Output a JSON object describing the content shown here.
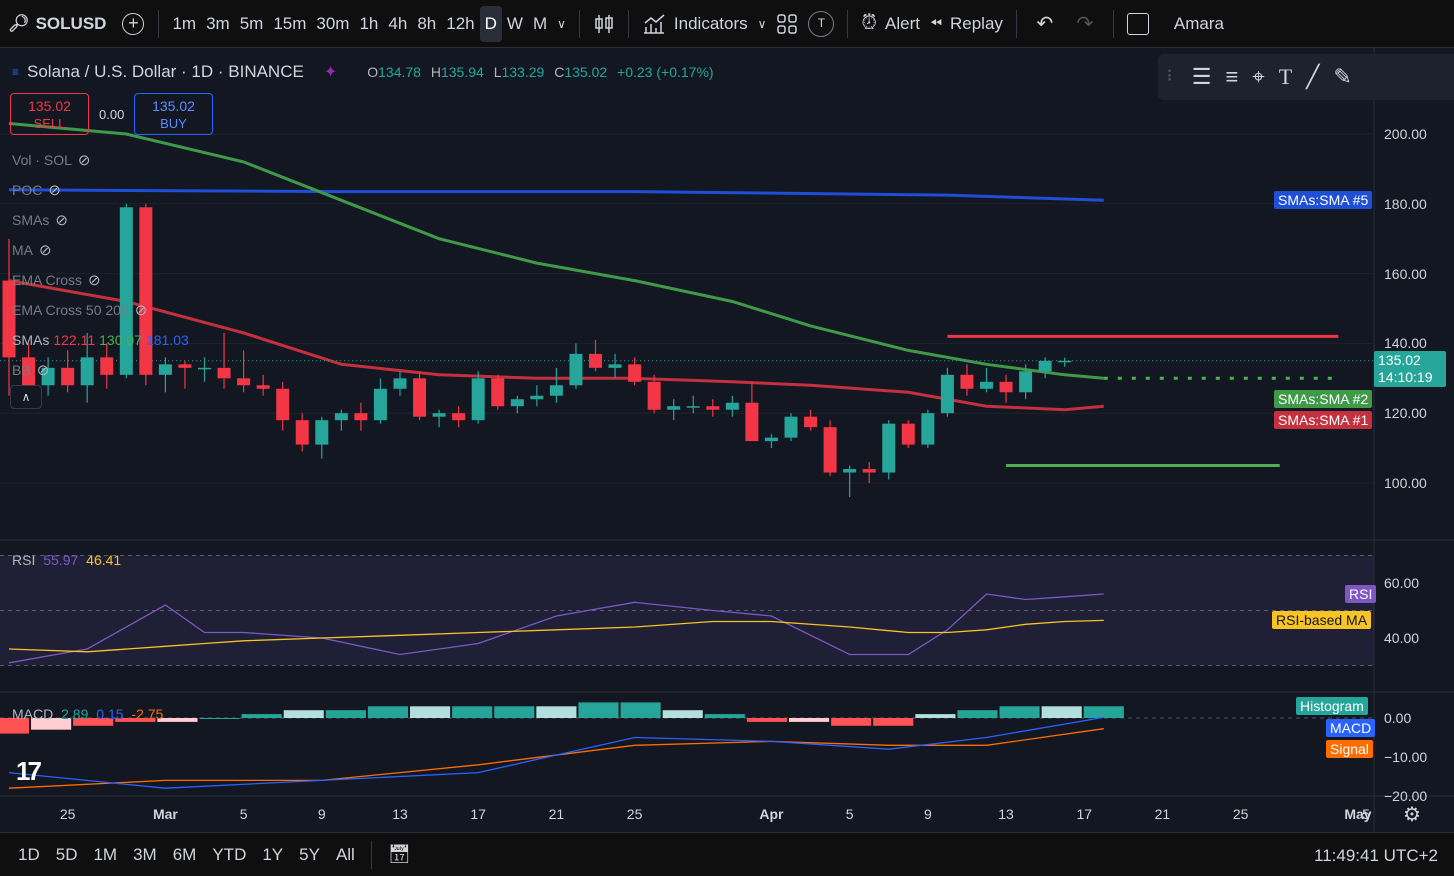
{
  "toolbar": {
    "symbol": "SOLUSD",
    "timeframes": [
      "1m",
      "3m",
      "5m",
      "15m",
      "30m",
      "1h",
      "4h",
      "8h",
      "12h",
      "D",
      "W",
      "M"
    ],
    "active_timeframe": "D",
    "indicators_label": "Indicators",
    "alert_label": "Alert",
    "replay_label": "Replay",
    "user_label": "Amara"
  },
  "header": {
    "title": "Solana / U.S. Dollar · 1D · BINANCE",
    "o_label": "O",
    "o": "134.78",
    "h_label": "H",
    "h": "135.94",
    "l_label": "L",
    "l": "133.29",
    "c_label": "C",
    "c": "135.02",
    "change": "+0.23 (+0.17%)"
  },
  "trade": {
    "sell_price": "135.02",
    "sell_label": "SELL",
    "buy_price": "135.02",
    "buy_label": "BUY",
    "spread": "0.00"
  },
  "indicators": {
    "vol": "Vol · SOL",
    "poc": "POC",
    "smas": "SMAs",
    "ma": "MA",
    "ema_cross": "EMA Cross",
    "ema_cross_50_200": "EMA Cross 50 200",
    "smas_values_label": "SMAs",
    "sma1_val": "122.11",
    "sma2_val": "130.07",
    "sma5_val": "181.03",
    "bb": "BB"
  },
  "rsi_pane": {
    "label": "RSI",
    "rsi_val": "55.97",
    "ma_val": "46.41",
    "tag_rsi": "RSI",
    "tag_ma": "RSI-based MA"
  },
  "macd_pane": {
    "label": "MACD",
    "hist_val": "2.89",
    "macd_val": "0.15",
    "signal_val": "-2.75",
    "tag_hist": "Histogram",
    "tag_macd": "MACD",
    "tag_signal": "Signal"
  },
  "price_axis": {
    "labels": [
      "200.00",
      "180.00",
      "160.00",
      "140.00",
      "120.00",
      "100.00"
    ],
    "current_price": "135.02",
    "countdown": "14:10:19",
    "tag_sma5": "SMAs:SMA #5",
    "tag_sma2": "SMAs:SMA #2",
    "tag_sma1": "SMAs:SMA #1"
  },
  "rsi_axis": {
    "labels": [
      "60.00",
      "40.00"
    ]
  },
  "macd_axis": {
    "labels": [
      "0.00",
      "−10.00",
      "−20.00"
    ]
  },
  "date_axis": {
    "labels": [
      "25",
      "Mar",
      "5",
      "9",
      "13",
      "17",
      "21",
      "25",
      "Apr",
      "5",
      "9",
      "13",
      "17",
      "21",
      "25",
      "May",
      "5"
    ]
  },
  "bottombar": {
    "ranges": [
      "1D",
      "5D",
      "1M",
      "3M",
      "6M",
      "YTD",
      "1Y",
      "5Y",
      "All"
    ],
    "clock": "11:49:41 UTC+2"
  },
  "colors": {
    "up": "#26a69a",
    "down": "#f23645",
    "sma1": "#c2313d",
    "sma2": "#3f9a48",
    "sma5": "#1e4fd6",
    "rsi": "#7e57c2",
    "rsi_ma": "#f7c325",
    "macd": "#2962ff",
    "signal": "#ff6d00"
  },
  "chart_data": {
    "type": "candlestick",
    "symbol": "SOLUSD",
    "interval": "1D",
    "exchange": "BINANCE",
    "x_range": [
      "2024-02-22",
      "2024-04-18"
    ],
    "candles": [
      {
        "date": "2024-02-22",
        "o": 158,
        "h": 170,
        "l": 125,
        "c": 136
      },
      {
        "date": "2024-02-23",
        "o": 136,
        "h": 140,
        "l": 124,
        "c": 127
      },
      {
        "date": "2024-02-24",
        "o": 128,
        "h": 136,
        "l": 125,
        "c": 133
      },
      {
        "date": "2024-02-25",
        "o": 133,
        "h": 138,
        "l": 126,
        "c": 128
      },
      {
        "date": "2024-02-26",
        "o": 128,
        "h": 143,
        "l": 123,
        "c": 136
      },
      {
        "date": "2024-02-27",
        "o": 136,
        "h": 140,
        "l": 127,
        "c": 131
      },
      {
        "date": "2024-02-28",
        "o": 131,
        "h": 180,
        "l": 130,
        "c": 179
      },
      {
        "date": "2024-02-29",
        "o": 179,
        "h": 180,
        "l": 128,
        "c": 131
      },
      {
        "date": "2024-03-01",
        "o": 131,
        "h": 136,
        "l": 126,
        "c": 134
      },
      {
        "date": "2024-03-02",
        "o": 134,
        "h": 135,
        "l": 127,
        "c": 133
      },
      {
        "date": "2024-03-03",
        "o": 133,
        "h": 136,
        "l": 129,
        "c": 133
      },
      {
        "date": "2024-03-04",
        "o": 133,
        "h": 143,
        "l": 127,
        "c": 130
      },
      {
        "date": "2024-03-05",
        "o": 130,
        "h": 138,
        "l": 126,
        "c": 128
      },
      {
        "date": "2024-03-06",
        "o": 128,
        "h": 131,
        "l": 125,
        "c": 127
      },
      {
        "date": "2024-03-07",
        "o": 127,
        "h": 129,
        "l": 115,
        "c": 118
      },
      {
        "date": "2024-03-08",
        "o": 118,
        "h": 120,
        "l": 109,
        "c": 111
      },
      {
        "date": "2024-03-09",
        "o": 111,
        "h": 119,
        "l": 107,
        "c": 118
      },
      {
        "date": "2024-03-10",
        "o": 118,
        "h": 121,
        "l": 115,
        "c": 120
      },
      {
        "date": "2024-03-11",
        "o": 120,
        "h": 123,
        "l": 115,
        "c": 118
      },
      {
        "date": "2024-03-12",
        "o": 118,
        "h": 130,
        "l": 117,
        "c": 127
      },
      {
        "date": "2024-03-13",
        "o": 127,
        "h": 132,
        "l": 125,
        "c": 130
      },
      {
        "date": "2024-03-14",
        "o": 130,
        "h": 132,
        "l": 118,
        "c": 119
      },
      {
        "date": "2024-03-15",
        "o": 119,
        "h": 121,
        "l": 116,
        "c": 120
      },
      {
        "date": "2024-03-16",
        "o": 120,
        "h": 122,
        "l": 116,
        "c": 118
      },
      {
        "date": "2024-03-17",
        "o": 118,
        "h": 132,
        "l": 117,
        "c": 130
      },
      {
        "date": "2024-03-18",
        "o": 130,
        "h": 131,
        "l": 121,
        "c": 122
      },
      {
        "date": "2024-03-19",
        "o": 122,
        "h": 125,
        "l": 120,
        "c": 124
      },
      {
        "date": "2024-03-20",
        "o": 124,
        "h": 128,
        "l": 122,
        "c": 125
      },
      {
        "date": "2024-03-21",
        "o": 125,
        "h": 133,
        "l": 123,
        "c": 128
      },
      {
        "date": "2024-03-22",
        "o": 128,
        "h": 140,
        "l": 127,
        "c": 137
      },
      {
        "date": "2024-03-23",
        "o": 137,
        "h": 141,
        "l": 132,
        "c": 133
      },
      {
        "date": "2024-03-24",
        "o": 133,
        "h": 137,
        "l": 130,
        "c": 134
      },
      {
        "date": "2024-03-25",
        "o": 134,
        "h": 136,
        "l": 128,
        "c": 129
      },
      {
        "date": "2024-03-26",
        "o": 129,
        "h": 131,
        "l": 120,
        "c": 121
      },
      {
        "date": "2024-03-27",
        "o": 121,
        "h": 124,
        "l": 118,
        "c": 122
      },
      {
        "date": "2024-03-28",
        "o": 122,
        "h": 125,
        "l": 120,
        "c": 122
      },
      {
        "date": "2024-03-29",
        "o": 122,
        "h": 124,
        "l": 119,
        "c": 121
      },
      {
        "date": "2024-03-30",
        "o": 121,
        "h": 125,
        "l": 119,
        "c": 123
      },
      {
        "date": "2024-03-31",
        "o": 123,
        "h": 129,
        "l": 118,
        "c": 112
      },
      {
        "date": "2024-04-01",
        "o": 112,
        "h": 114,
        "l": 110,
        "c": 113
      },
      {
        "date": "2024-04-02",
        "o": 113,
        "h": 120,
        "l": 112,
        "c": 119
      },
      {
        "date": "2024-04-03",
        "o": 119,
        "h": 121,
        "l": 115,
        "c": 116
      },
      {
        "date": "2024-04-04",
        "o": 116,
        "h": 118,
        "l": 102,
        "c": 103
      },
      {
        "date": "2024-04-05",
        "o": 103,
        "h": 105,
        "l": 96,
        "c": 104
      },
      {
        "date": "2024-04-06",
        "o": 104,
        "h": 106,
        "l": 100,
        "c": 103
      },
      {
        "date": "2024-04-07",
        "o": 103,
        "h": 118,
        "l": 101,
        "c": 117
      },
      {
        "date": "2024-04-08",
        "o": 117,
        "h": 118,
        "l": 110,
        "c": 111
      },
      {
        "date": "2024-04-09",
        "o": 111,
        "h": 121,
        "l": 110,
        "c": 120
      },
      {
        "date": "2024-04-10",
        "o": 120,
        "h": 133,
        "l": 119,
        "c": 131
      },
      {
        "date": "2024-04-11",
        "o": 131,
        "h": 134,
        "l": 125,
        "c": 127
      },
      {
        "date": "2024-04-12",
        "o": 127,
        "h": 133,
        "l": 126,
        "c": 129
      },
      {
        "date": "2024-04-13",
        "o": 129,
        "h": 131,
        "l": 123,
        "c": 126
      },
      {
        "date": "2024-04-14",
        "o": 126,
        "h": 134,
        "l": 124,
        "c": 132
      },
      {
        "date": "2024-04-15",
        "o": 132,
        "h": 136,
        "l": 130,
        "c": 135
      },
      {
        "date": "2024-04-16",
        "o": 134.78,
        "h": 135.94,
        "l": 133.29,
        "c": 135.02
      }
    ],
    "sma1": {
      "name": "SMAs:SMA #1",
      "dates": [
        "2024-02-22",
        "2024-02-28",
        "2024-03-05",
        "2024-03-10",
        "2024-03-15",
        "2024-03-20",
        "2024-03-25",
        "2024-03-30",
        "2024-04-03",
        "2024-04-08",
        "2024-04-12",
        "2024-04-16",
        "2024-04-18"
      ],
      "values": [
        158,
        152,
        143,
        134,
        131,
        130,
        130,
        129,
        128,
        126,
        122,
        121,
        122
      ]
    },
    "sma2": {
      "name": "SMAs:SMA #2",
      "dates": [
        "2024-02-22",
        "2024-02-28",
        "2024-03-05",
        "2024-03-10",
        "2024-03-15",
        "2024-03-20",
        "2024-03-25",
        "2024-03-30",
        "2024-04-03",
        "2024-04-08",
        "2024-04-12",
        "2024-04-16",
        "2024-04-18"
      ],
      "values": [
        203,
        200,
        192,
        181,
        170,
        163,
        158,
        152,
        145,
        138,
        134,
        131,
        130
      ]
    },
    "sma5": {
      "name": "SMAs:SMA #5",
      "dates": [
        "2024-02-22",
        "2024-03-10",
        "2024-03-25",
        "2024-04-10",
        "2024-04-18"
      ],
      "values": [
        184,
        183.5,
        183.5,
        182.5,
        181
      ]
    },
    "horizontal_lines": [
      {
        "color": "#f23645",
        "value": 142,
        "from": "2024-04-10",
        "to": "2024-04-30"
      },
      {
        "color": "#4caf50",
        "value": 130,
        "from": "2024-04-18",
        "to": "2024-04-30",
        "style": "dotted"
      },
      {
        "color": "#4caf50",
        "value": 105,
        "from": "2024-04-13",
        "to": "2024-04-27"
      }
    ],
    "y_range": [
      90,
      215
    ],
    "rsi": {
      "dates": [
        "2024-02-22",
        "2024-02-26",
        "2024-03-01",
        "2024-03-03",
        "2024-03-05",
        "2024-03-09",
        "2024-03-13",
        "2024-03-17",
        "2024-03-21",
        "2024-03-25",
        "2024-03-29",
        "2024-04-01",
        "2024-04-05",
        "2024-04-08",
        "2024-04-10",
        "2024-04-12",
        "2024-04-14",
        "2024-04-16",
        "2024-04-18"
      ],
      "values": [
        31,
        36,
        52,
        42,
        42,
        40,
        34,
        38,
        48,
        53,
        50,
        48,
        34,
        34,
        43,
        56,
        54,
        55,
        56
      ],
      "ylim": [
        25,
        70
      ]
    },
    "rsi_ma": {
      "values": [
        36,
        35,
        37,
        38,
        39,
        40,
        41,
        42,
        43,
        44,
        46,
        46,
        44,
        42,
        42,
        43,
        45,
        46,
        46.41
      ]
    },
    "macd": {
      "dates": [
        "2024-02-22",
        "2024-03-01",
        "2024-03-09",
        "2024-03-17",
        "2024-03-25",
        "2024-04-01",
        "2024-04-07",
        "2024-04-12",
        "2024-04-18"
      ],
      "macd": [
        -14,
        -18,
        -16,
        -14,
        -5,
        -6,
        -8,
        -5,
        0.15
      ],
      "signal": [
        -18,
        -16,
        -16,
        -12,
        -7,
        -6,
        -7,
        -7,
        -2.75
      ],
      "ylim": [
        -22,
        4
      ]
    },
    "histogram": {
      "values": [
        -4,
        -3,
        -2,
        -1,
        -1,
        0,
        1,
        2,
        2,
        3,
        3,
        3,
        3,
        3,
        4,
        4,
        2,
        1,
        -1,
        -1,
        -2,
        -2,
        1,
        2,
        3,
        3,
        3
      ]
    }
  }
}
